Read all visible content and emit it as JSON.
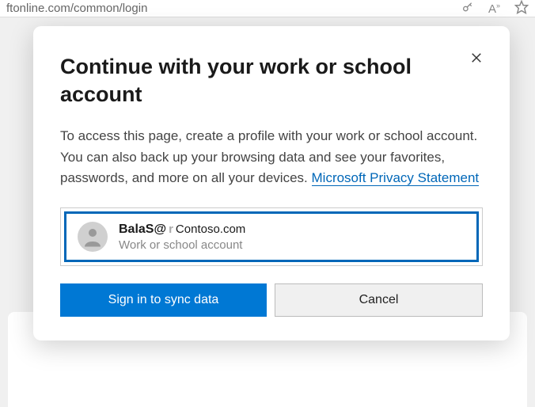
{
  "url_bar": {
    "url_fragment": "ftonline.com/common/login"
  },
  "dialog": {
    "title": "Continue with your work or school account",
    "body_text": "To access this page, create a profile with your work or school account. You can also back up your browsing data and see your favorites, passwords, and more on all your devices. ",
    "privacy_link": "Microsoft Privacy Statement",
    "account": {
      "email_prefix": "BalaS@",
      "email_faded": "r",
      "email_domain": "Contoso.com",
      "type_label": "Work or school account"
    },
    "primary_button": "Sign in to sync data",
    "secondary_button": "Cancel"
  }
}
